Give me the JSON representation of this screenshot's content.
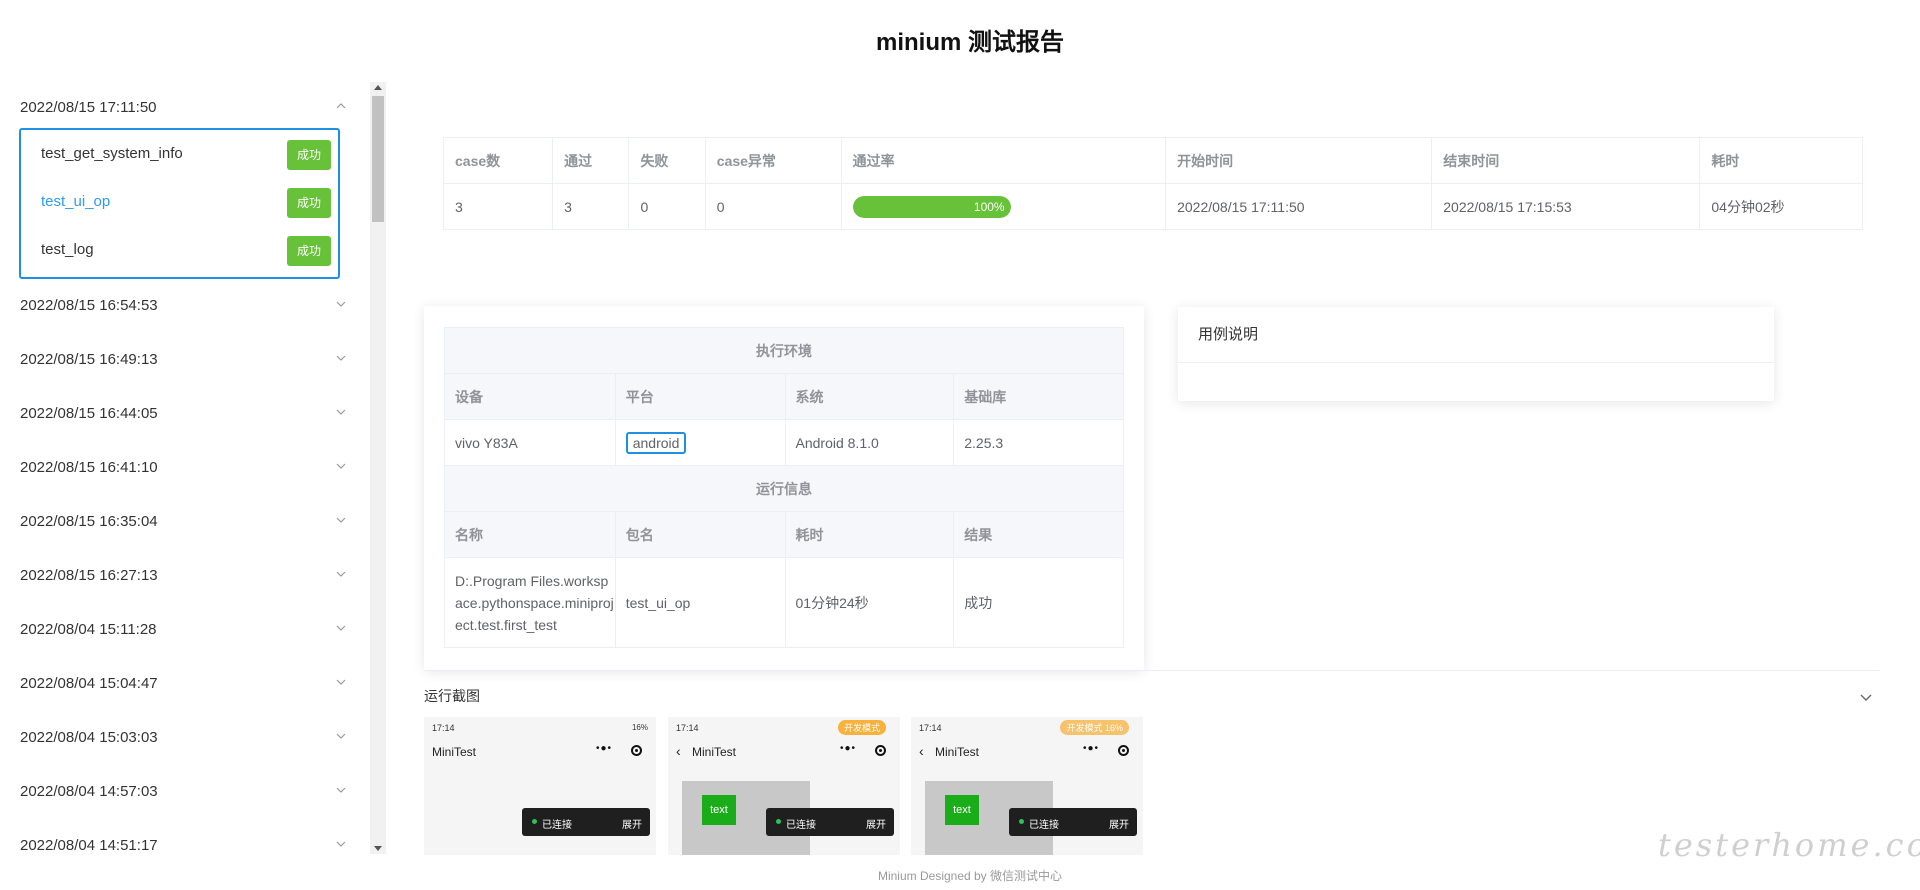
{
  "title": "minium 测试报告",
  "sidebar": {
    "groups": [
      {
        "date": "2022/08/15 17:11:50",
        "expanded": true
      },
      {
        "date": "2022/08/15 16:54:53"
      },
      {
        "date": "2022/08/15 16:49:13"
      },
      {
        "date": "2022/08/15 16:44:05"
      },
      {
        "date": "2022/08/15 16:41:10"
      },
      {
        "date": "2022/08/15 16:35:04"
      },
      {
        "date": "2022/08/15 16:27:13"
      },
      {
        "date": "2022/08/04 15:11:28"
      },
      {
        "date": "2022/08/04 15:04:47"
      },
      {
        "date": "2022/08/04 15:03:03"
      },
      {
        "date": "2022/08/04 14:57:03"
      },
      {
        "date": "2022/08/04 14:51:17"
      }
    ],
    "cases": [
      {
        "name": "test_get_system_info",
        "status": "成功"
      },
      {
        "name": "test_ui_op",
        "status": "成功",
        "active": true
      },
      {
        "name": "test_log",
        "status": "成功"
      }
    ]
  },
  "summary": {
    "headers": [
      "case数",
      "通过",
      "失败",
      "case异常",
      "通过率",
      "开始时间",
      "结束时间",
      "耗时"
    ],
    "row": {
      "cases": "3",
      "passed": "3",
      "failed": "0",
      "errors": "0",
      "pass_rate": 100,
      "pass_rate_label": "100%",
      "start": "2022/08/15 17:11:50",
      "end": "2022/08/15 17:15:53",
      "duration": "04分钟02秒"
    }
  },
  "env": {
    "section_env": "执行环境",
    "env_headers": [
      "设备",
      "平台",
      "系统",
      "基础库"
    ],
    "env_values": [
      "vivo Y83A",
      "android",
      "Android 8.1.0",
      "2.25.3"
    ],
    "section_run": "运行信息",
    "run_headers": [
      "名称",
      "包名",
      "耗时",
      "结果"
    ],
    "run_values": [
      "D:.Program Files.workspace.pythonspace.miniproject.test.first_test",
      "test_ui_op",
      "01分钟24秒",
      "成功"
    ]
  },
  "desc": {
    "title": "用例说明"
  },
  "screenshots": {
    "label": "运行截图",
    "items": [
      {
        "time": "17:14",
        "battery": "16%",
        "title": "MiniTest",
        "connected": "已连接",
        "expand": "展开"
      },
      {
        "time": "17:14",
        "tag": "开发模式",
        "title": "MiniTest",
        "button": "text",
        "connected": "已连接",
        "expand": "展开"
      },
      {
        "time": "17:14",
        "battery": "16%",
        "tag": "开发模式",
        "title": "MiniTest",
        "button": "text",
        "connected": "已连接",
        "expand": "展开"
      }
    ]
  },
  "footer": "Minium Designed by 微信测试中心",
  "watermark": "testerhome.com",
  "colors": {
    "accent": "#1e8fe1",
    "success": "#67c23a",
    "active_link": "#2d9bf0"
  }
}
